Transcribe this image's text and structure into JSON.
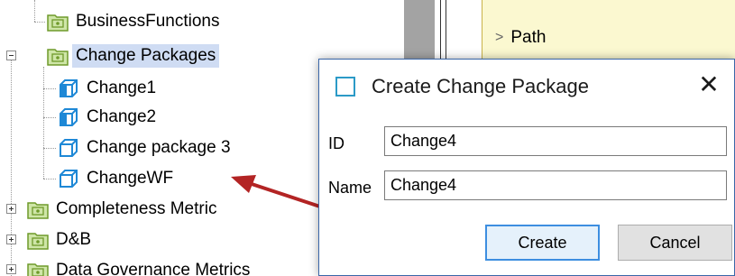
{
  "tree": {
    "items": [
      {
        "label": "BusinessFunctions",
        "icon": "folder-icon"
      },
      {
        "label": "Change Packages",
        "icon": "folder-icon",
        "expanded": true,
        "selected": true
      },
      {
        "label": "Change1",
        "icon": "change-package-open-icon"
      },
      {
        "label": "Change2",
        "icon": "change-package-open-icon"
      },
      {
        "label": "Change package 3",
        "icon": "change-package-icon"
      },
      {
        "label": "ChangeWF",
        "icon": "change-package-icon"
      },
      {
        "label": "Completeness Metric",
        "icon": "folder-icon",
        "expanded": false
      },
      {
        "label": "D&B",
        "icon": "folder-icon",
        "expanded": false
      },
      {
        "label": "Data Governance Metrics",
        "icon": "folder-icon",
        "expanded": false
      }
    ]
  },
  "background_panel": {
    "path_label": "Path"
  },
  "dialog": {
    "title": "Create Change Package",
    "close_glyph": "✕",
    "fields": {
      "id": {
        "label": "ID",
        "value": "Change4"
      },
      "name": {
        "label": "Name",
        "value": "Change4"
      }
    },
    "buttons": {
      "create": "Create",
      "cancel": "Cancel"
    }
  },
  "colors": {
    "selection": "#cfdcf3",
    "folder": "#8fb53a",
    "change_icon": "#1e88d6",
    "arrow": "#b32424",
    "path_panel": "#fbf8d0"
  }
}
